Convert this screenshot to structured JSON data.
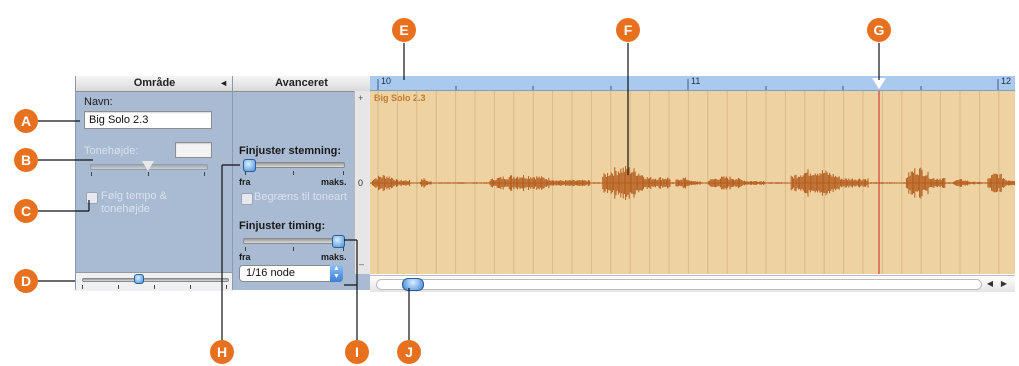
{
  "left_panel": {
    "header": "Område",
    "header_arrow": "◄",
    "name_label": "Navn:",
    "name_value": "Big Solo 2.3",
    "pitch_label": "Tonehøjde:",
    "follow_label_line1": "Følg tempo &",
    "follow_label_line2": "tonehøjde"
  },
  "mid_panel": {
    "header": "Avanceret",
    "fine_pitch_label": "Finjuster stemning:",
    "fine_pitch_min": "fra",
    "fine_pitch_max": "maks.",
    "limit_key_label": "Begræns til toneart",
    "fine_timing_label": "Finjuster timing:",
    "fine_timing_min": "fra",
    "fine_timing_max": "maks.",
    "timing_select_value": "1/16 node",
    "fine_pitch_level": 0.0,
    "fine_timing_level": 1.0
  },
  "arrange": {
    "ruler_bars": [
      "10",
      "11",
      "12"
    ],
    "region_name": "Big Solo 2.3",
    "zero_label": "0",
    "plus_label": "+",
    "minus_label": "–",
    "colors": {
      "ruler": "#a9c9ef",
      "region": "#efd2a1",
      "waveform": "#b35a1a",
      "playhead": "#cc2222"
    }
  },
  "callouts": [
    "A",
    "B",
    "C",
    "D",
    "E",
    "F",
    "G",
    "H",
    "I",
    "J"
  ]
}
